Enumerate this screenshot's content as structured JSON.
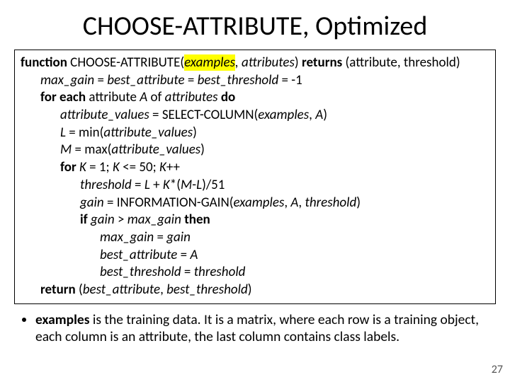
{
  "title": "CHOOSE-ATTRIBUTE, Optimized",
  "code": {
    "fn_kw": "function",
    "fn_name": " CHOOSE-ATTRIBUTE(",
    "fn_arg1": "examples",
    "fn_args_rest": ", attributes",
    "fn_paren_close": ") ",
    "returns_kw": "returns",
    "returns_rest": " (attribute, threshold)",
    "l2_a": "max_gain",
    "l2_b": " = ",
    "l2_c": "best_attribute",
    "l2_d": " = ",
    "l2_e": "best_threshold",
    "l2_f": " = -1",
    "l3_a": "for each",
    "l3_b": " attribute ",
    "l3_c": "A",
    "l3_d": " of ",
    "l3_e": "attributes",
    "l3_f": " ",
    "l3_g": "do",
    "l4_a": "attribute_values",
    "l4_b": " = SELECT-COLUMN(",
    "l4_c": "examples",
    "l4_d": ", ",
    "l4_e": "A",
    "l4_f": ")",
    "l5_a": "L",
    "l5_b": " = min(",
    "l5_c": "attribute_values",
    "l5_d": ")",
    "l6_a": "M",
    "l6_b": " = max(",
    "l6_c": "attribute_values",
    "l6_d": ")",
    "l7_a": "for",
    "l7_b": " ",
    "l7_c": "K",
    "l7_d": " = 1; ",
    "l7_e": "K",
    "l7_f": " <= 50; ",
    "l7_g": "K",
    "l7_h": "++",
    "l8_a": "threshold",
    "l8_b": " = ",
    "l8_c": "L",
    "l8_d": " + ",
    "l8_e": "K",
    "l8_f": "*(",
    "l8_g": "M",
    "l8_h": "-",
    "l8_i": "L",
    "l8_j": ")/51",
    "l9_a": "gain",
    "l9_b": " = INFORMATION-GAIN(",
    "l9_c": "examples",
    "l9_d": ", ",
    "l9_e": "A",
    "l9_f": ", ",
    "l9_g": "threshold",
    "l9_h": ")",
    "l10_a": "if",
    "l10_b": " ",
    "l10_c": "gain",
    "l10_d": " > ",
    "l10_e": "max_gain",
    "l10_f": " ",
    "l10_g": "then",
    "l11_a": "max_gain",
    "l11_b": " = ",
    "l11_c": "gain",
    "l12_a": "best_attribute",
    "l12_b": " = ",
    "l12_c": "A",
    "l13_a": "best_threshold",
    "l13_b": " = ",
    "l13_c": "threshold",
    "l14_a": "return",
    "l14_b": " (",
    "l14_c": "best_attribute",
    "l14_d": ", ",
    "l14_e": "best_threshold",
    "l14_f": ")"
  },
  "bullet": {
    "bold": "examples",
    "rest": " is the training data. It is a matrix, where each row is a training object, each column is an attribute, the last column contains class labels."
  },
  "pagenum": "27"
}
